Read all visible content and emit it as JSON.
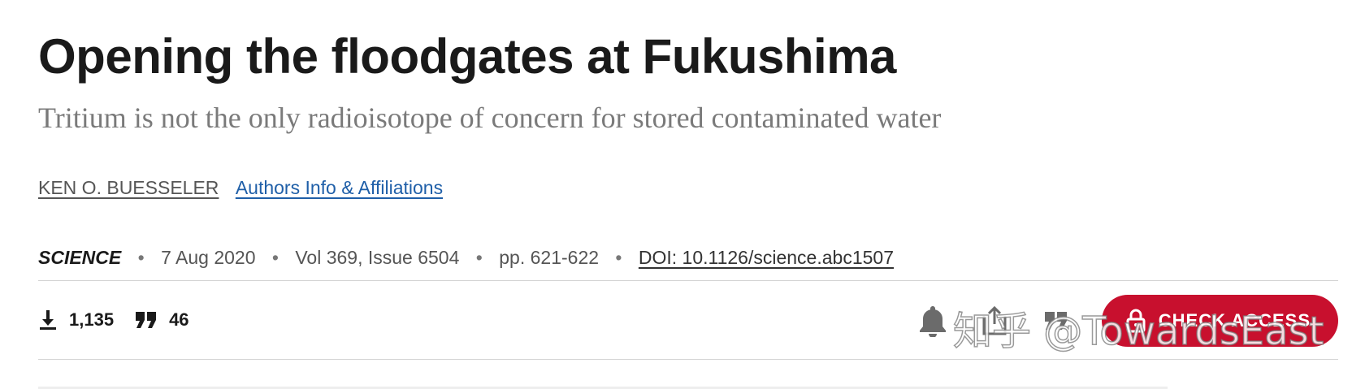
{
  "article": {
    "title": "Opening the floodgates at Fukushima",
    "subtitle": "Tritium is not the only radioisotope of concern for stored contaminated water"
  },
  "authors": {
    "name": "KEN O. BUESSELER",
    "affiliations_link": "Authors Info & Affiliations"
  },
  "meta": {
    "journal": "SCIENCE",
    "date": "7 Aug 2020",
    "volume_issue": "Vol 369, Issue 6504",
    "pages": "pp. 621-622",
    "doi": "DOI: 10.1126/science.abc1507",
    "separator": "•"
  },
  "metrics": {
    "downloads": "1,135",
    "citations": "46",
    "download_icon": "download-icon",
    "citation_icon": "quote-icon"
  },
  "actions": {
    "alert_icon": "bell-icon",
    "share_icon": "share-icon",
    "cite_icon": "quote-icon",
    "check_access_label": "CHECK ACCESS",
    "check_access_icon": "lock-icon"
  },
  "watermark": {
    "text": "知乎 @TowardsEast"
  },
  "colors": {
    "title": "#1a1a1a",
    "subtitle": "#7a7a7a",
    "link": "#1f5fa8",
    "accent": "#c8102e",
    "rule": "#d4d4d4"
  }
}
